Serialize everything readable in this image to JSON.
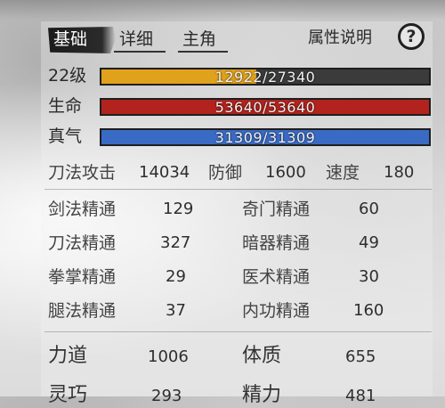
{
  "tabs": [
    {
      "label": "基础",
      "active": true
    },
    {
      "label": "详细",
      "active": false
    },
    {
      "label": "主角",
      "active": false
    }
  ],
  "help": {
    "label": "属性说明",
    "icon": "?"
  },
  "bars": [
    {
      "label": "22级",
      "text": "12922/27340",
      "fraction": 0.4726,
      "color": "#e0a21c"
    },
    {
      "label": "生命",
      "text": "53640/53640",
      "fraction": 1.0,
      "color": "#b3231e"
    },
    {
      "label": "真气",
      "text": "31309/31309",
      "fraction": 1.0,
      "color": "#3a6bc4"
    }
  ],
  "combat": [
    {
      "label": "刀法攻击",
      "value": "14034"
    },
    {
      "label": "防御",
      "value": "1600"
    },
    {
      "label": "速度",
      "value": "180"
    }
  ],
  "skills_left": [
    {
      "label": "剑法精通",
      "value": "129"
    },
    {
      "label": "刀法精通",
      "value": "327"
    },
    {
      "label": "拳掌精通",
      "value": "29"
    },
    {
      "label": "腿法精通",
      "value": "37"
    }
  ],
  "skills_right": [
    {
      "label": "奇门精通",
      "value": "60"
    },
    {
      "label": "暗器精通",
      "value": "49"
    },
    {
      "label": "医术精通",
      "value": "30"
    },
    {
      "label": "内功精通",
      "value": "160"
    }
  ],
  "attributes": [
    {
      "label": "力道",
      "value": "1006"
    },
    {
      "label": "体质",
      "value": "655"
    },
    {
      "label": "灵巧",
      "value": "293"
    },
    {
      "label": "精力",
      "value": "481"
    }
  ]
}
